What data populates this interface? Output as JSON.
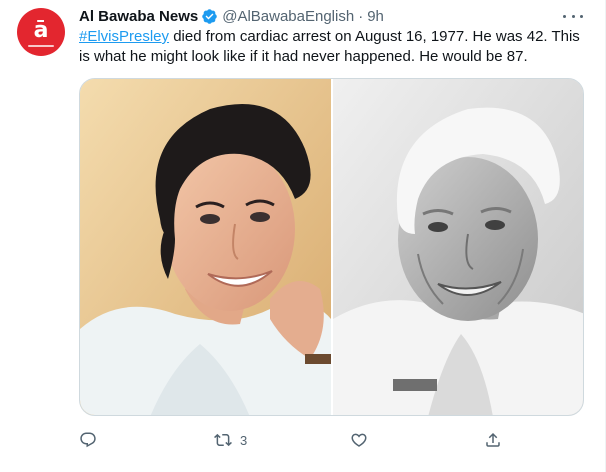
{
  "tweet": {
    "author_name": "Al Bawaba News",
    "handle": "@AlBawabaEnglish",
    "separator": "·",
    "time": "9h",
    "text_hashtag": "#ElvisPresley",
    "text_body": " died from cardiac arrest on August 16, 1977. He was 42. This is what he might look like if it had never happened. He would be 87.",
    "avatar_glyph": "ā",
    "avatar_color": "#e3262f",
    "verified_color": "#1d9bf0",
    "link_color": "#1d9bf0"
  },
  "media": {
    "left_photo": "portrait-young-man-color",
    "right_photo": "portrait-older-man-black-and-white"
  },
  "actions": {
    "reply_icon": "reply-icon",
    "retweet_icon": "retweet-icon",
    "retweet_count": "3",
    "like_icon": "heart-icon",
    "share_icon": "share-icon"
  }
}
